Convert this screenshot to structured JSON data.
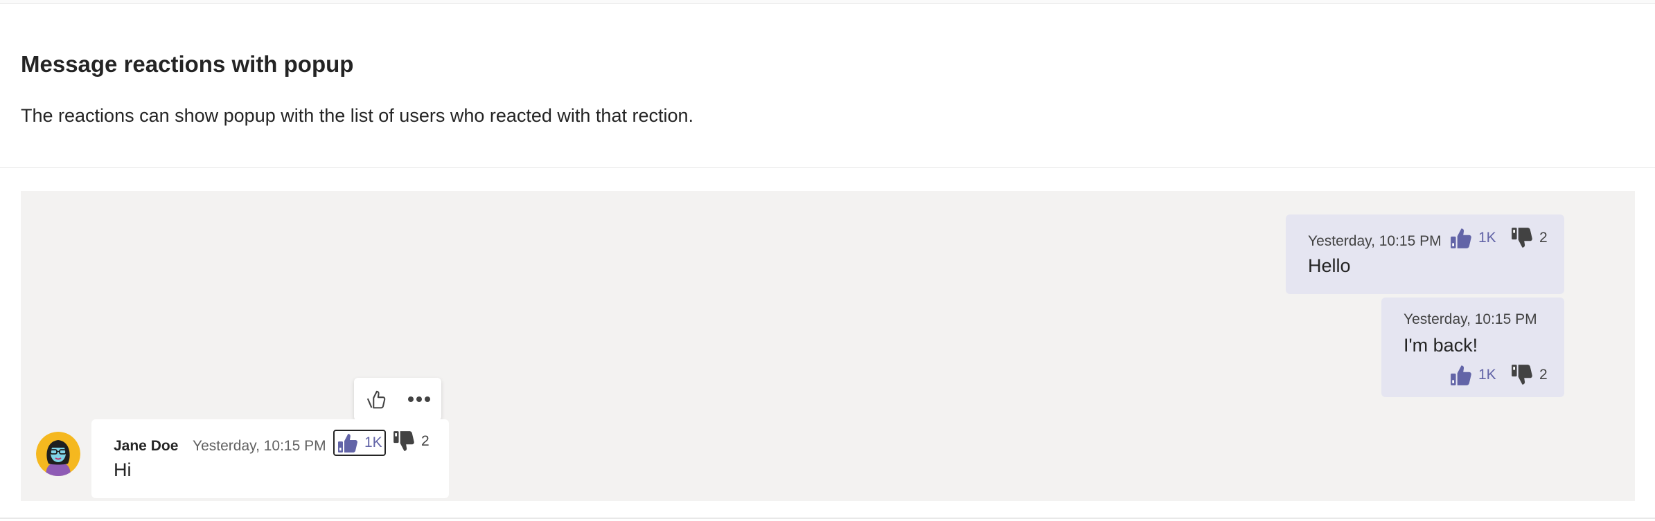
{
  "page": {
    "title": "Message reactions with popup",
    "description": "The reactions can show popup with the list of users who reacted with that rection."
  },
  "messages": [
    {
      "timestamp": "Yesterday, 10:15 PM",
      "text": "Hello",
      "reactions": [
        {
          "icon": "thumbs-up-icon",
          "count": "1K"
        },
        {
          "icon": "thumbs-down-icon",
          "count": "2"
        }
      ]
    },
    {
      "timestamp": "Yesterday, 10:15 PM",
      "text": "I'm back!",
      "reactions": [
        {
          "icon": "thumbs-up-icon",
          "count": "1K"
        },
        {
          "icon": "thumbs-down-icon",
          "count": "2"
        }
      ]
    },
    {
      "author": "Jane Doe",
      "timestamp": "Yesterday, 10:15 PM",
      "text": "Hi",
      "reactions": [
        {
          "icon": "thumbs-up-icon",
          "count": "1K"
        },
        {
          "icon": "thumbs-down-icon",
          "count": "2"
        }
      ]
    }
  ],
  "action_menu": {
    "items": [
      "thumbs-up-icon",
      "more-options-icon"
    ]
  },
  "colors": {
    "stage_background": "#f3f2f1",
    "outgoing_bubble": "#e5e5f1",
    "incoming_bubble": "#ffffff",
    "like_accent": "#6264a7",
    "dislike": "#424242",
    "avatar_background": "#f5b81f"
  }
}
